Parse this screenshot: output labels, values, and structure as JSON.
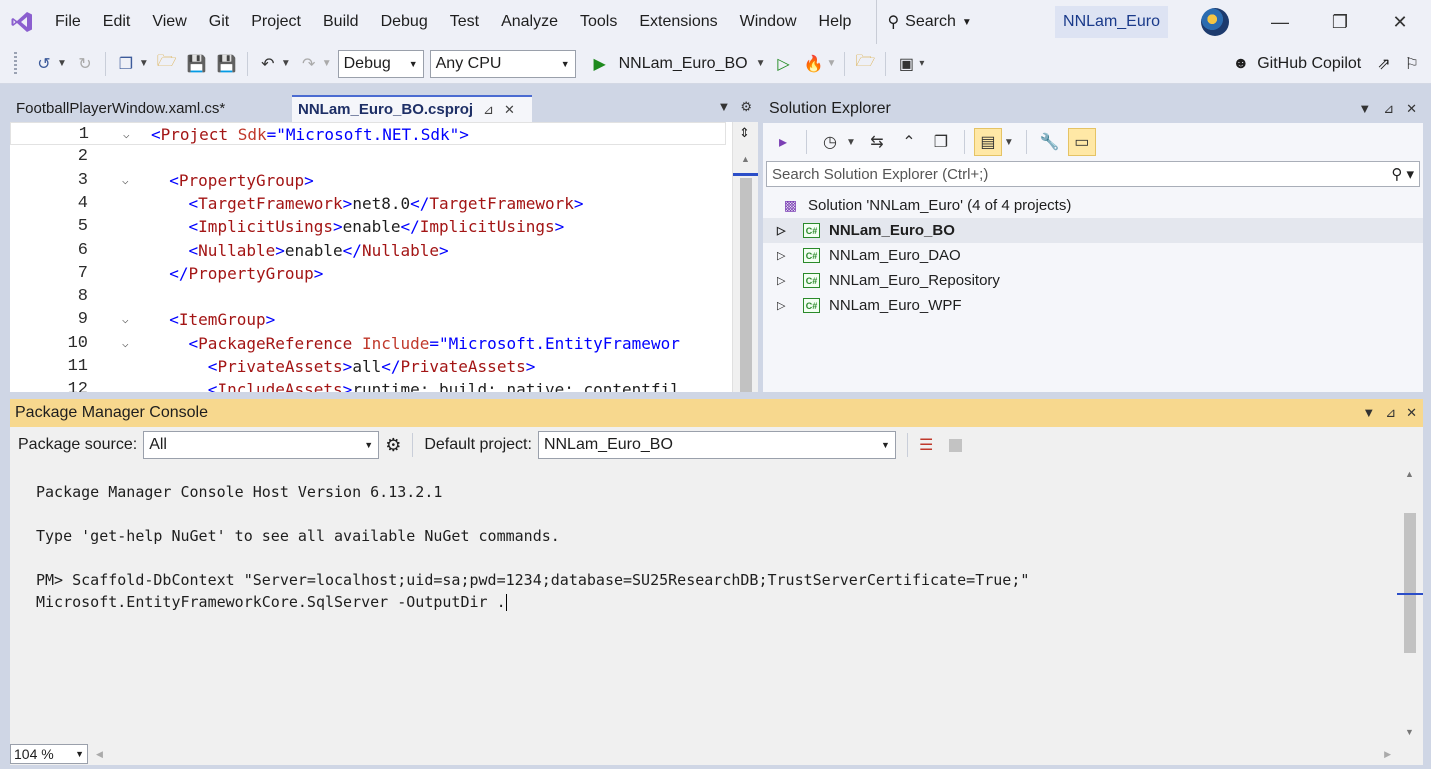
{
  "menubar": {
    "items": [
      "File",
      "Edit",
      "View",
      "Git",
      "Project",
      "Build",
      "Debug",
      "Test",
      "Analyze",
      "Tools",
      "Extensions",
      "Window",
      "Help"
    ],
    "search_label": "Search",
    "solution_title": "NNLam_Euro",
    "window_controls": [
      "minimize-icon",
      "restore-icon",
      "close-icon"
    ]
  },
  "toolbar": {
    "configuration": "Debug",
    "platform": "Any CPU",
    "startup_project": "NNLam_Euro_BO",
    "copilot_label": "GitHub Copilot"
  },
  "editor": {
    "tabs": [
      {
        "label": "FootballPlayerWindow.xaml.cs*",
        "active": false
      },
      {
        "label": "NNLam_Euro_BO.csproj",
        "active": true
      }
    ],
    "lines": [
      {
        "n": "1",
        "fold": "v",
        "html": "<span class='b'>&lt;</span><span class='t'>Project</span> <span class='a'>Sdk</span><span class='b'>=</span><span class='s'>\"Microsoft.NET.Sdk\"</span><span class='b'>&gt;</span>"
      },
      {
        "n": "2",
        "fold": "",
        "html": ""
      },
      {
        "n": "3",
        "fold": "v",
        "html": "  <span class='b'>&lt;</span><span class='t'>PropertyGroup</span><span class='b'>&gt;</span>"
      },
      {
        "n": "4",
        "fold": "",
        "html": "    <span class='b'>&lt;</span><span class='t'>TargetFramework</span><span class='b'>&gt;</span><span class='v'>net8.0</span><span class='b'>&lt;/</span><span class='t'>TargetFramework</span><span class='b'>&gt;</span>"
      },
      {
        "n": "5",
        "fold": "",
        "html": "    <span class='b'>&lt;</span><span class='t'>ImplicitUsings</span><span class='b'>&gt;</span><span class='v'>enable</span><span class='b'>&lt;/</span><span class='t'>ImplicitUsings</span><span class='b'>&gt;</span>"
      },
      {
        "n": "6",
        "fold": "",
        "html": "    <span class='b'>&lt;</span><span class='t'>Nullable</span><span class='b'>&gt;</span><span class='v'>enable</span><span class='b'>&lt;/</span><span class='t'>Nullable</span><span class='b'>&gt;</span>"
      },
      {
        "n": "7",
        "fold": "",
        "html": "  <span class='b'>&lt;/</span><span class='t'>PropertyGroup</span><span class='b'>&gt;</span>"
      },
      {
        "n": "8",
        "fold": "",
        "html": ""
      },
      {
        "n": "9",
        "fold": "v",
        "html": "  <span class='b'>&lt;</span><span class='t'>ItemGroup</span><span class='b'>&gt;</span>"
      },
      {
        "n": "10",
        "fold": "v",
        "html": "    <span class='b'>&lt;</span><span class='t'>PackageReference</span> <span class='a'>Include</span><span class='b'>=</span><span class='s'>\"Microsoft.EntityFramewor</span>"
      },
      {
        "n": "11",
        "fold": "",
        "html": "      <span class='b'>&lt;</span><span class='t'>PrivateAssets</span><span class='b'>&gt;</span><span class='v'>all</span><span class='b'>&lt;/</span><span class='t'>PrivateAssets</span><span class='b'>&gt;</span>"
      },
      {
        "n": "12",
        "fold": "",
        "html": "      <span class='b'>&lt;</span><span class='t'>IncludeAssets</span><span class='b'>&gt;</span><span class='v'>runtime; build; native; contentfil</span>"
      }
    ]
  },
  "solution_explorer": {
    "title": "Solution Explorer",
    "search_placeholder": "Search Solution Explorer (Ctrl+;)",
    "solution_label": "Solution 'NNLam_Euro' (4 of 4 projects)",
    "projects": [
      {
        "name": "NNLam_Euro_BO",
        "selected": true
      },
      {
        "name": "NNLam_Euro_DAO",
        "selected": false
      },
      {
        "name": "NNLam_Euro_Repository",
        "selected": false
      },
      {
        "name": "NNLam_Euro_WPF",
        "selected": false
      }
    ]
  },
  "pmc": {
    "title": "Package Manager Console",
    "package_source_label": "Package source:",
    "package_source_value": "All",
    "default_project_label": "Default project:",
    "default_project_value": "NNLam_Euro_BO",
    "output_lines": [
      "Package Manager Console Host Version 6.13.2.1",
      "",
      "Type 'get-help NuGet' to see all available NuGet commands.",
      "",
      "PM> Scaffold-DbContext \"Server=localhost;uid=sa;pwd=1234;database=SU25ResearchDB;TrustServerCertificate=True;\"",
      "Microsoft.EntityFrameworkCore.SqlServer -OutputDir ."
    ],
    "zoom": "104 %"
  }
}
